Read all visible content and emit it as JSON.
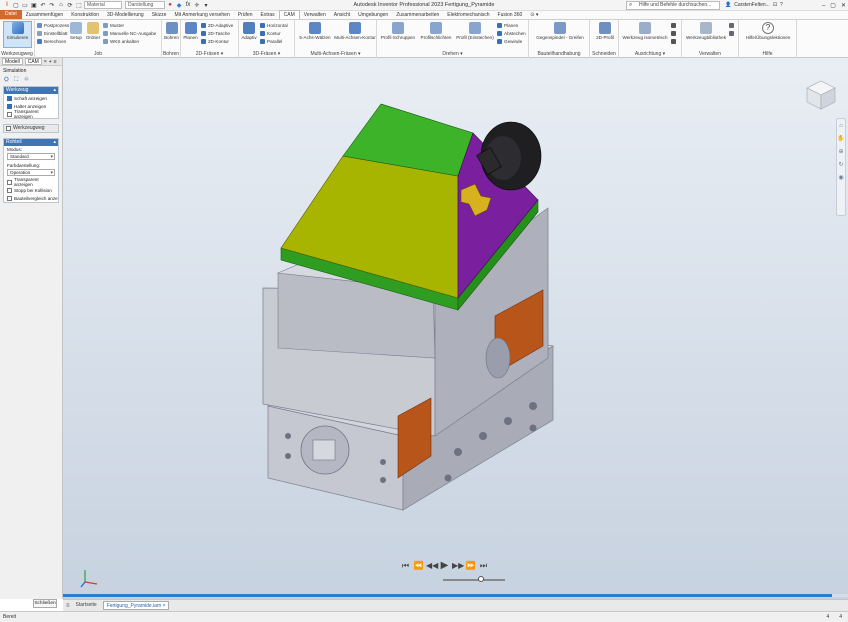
{
  "window": {
    "title": "Autodesk Inventor Professional 2023   Fertigung_Pyramide",
    "search_placeholder": "Hilfe und Befehle durchsuchen...",
    "user": "CarstenFelten...",
    "controls": [
      "–",
      "▢",
      "✕"
    ]
  },
  "qat": {
    "material": "Material",
    "appearance": "Darstellung",
    "fx": "fx"
  },
  "tabs": [
    {
      "label": "Datei"
    },
    {
      "label": "Zusammenfügen"
    },
    {
      "label": "Konstruktion"
    },
    {
      "label": "3D-Modellierung"
    },
    {
      "label": "Skizze"
    },
    {
      "label": "Mit Anmerkung versehen"
    },
    {
      "label": "Prüfen"
    },
    {
      "label": "Extras"
    },
    {
      "label": "CAM"
    },
    {
      "label": "Verwalten"
    },
    {
      "label": "Ansicht"
    },
    {
      "label": "Umgebungen"
    },
    {
      "label": "Zusammenarbeiten"
    },
    {
      "label": "Elektromechanisch"
    },
    {
      "label": "Fusion 360"
    },
    {
      "label": "⊙ ▾"
    }
  ],
  "ribbon": {
    "werkzeugweg": {
      "label": "Werkzeugweg",
      "simulate": "Simulieren"
    },
    "job": {
      "label": "Job",
      "setup": "Setup",
      "folder": "Ordner",
      "small": [
        "Postprozess",
        "Einstellblatt",
        "Berechnen"
      ],
      "small2": [
        "Muster",
        "Manuelle NC-Ausgabe",
        "WKS ankalten"
      ]
    },
    "bohren": {
      "label": "Bohren",
      "btn": "Bohren"
    },
    "fraesen2d": {
      "label": "2D-Fräsen ▾",
      "big": "Planen",
      "small": [
        "2D-Adaptive",
        "2D-Tasche",
        "2D-Kontur"
      ]
    },
    "fraesen3d": {
      "label": "3D-Fräsen ▾",
      "big": "Adaptiv",
      "small": [
        "Horizontal",
        "Kontur",
        "Parallel"
      ]
    },
    "multiachsen": {
      "label": "Multi-Achsen-Fräsen ▾",
      "b1": "5-Achs-Wälzen",
      "b2": "Multi-Achsen-Kontur"
    },
    "drehen": {
      "label": "Drehen ▾",
      "b1": "Profil-Schruppen",
      "b2": "Profilschlichten",
      "b3": "Profil (Einstechen)",
      "small": [
        "Planen",
        "Abstechen",
        "Gewinde"
      ]
    },
    "bauteil": {
      "label": "Bauteilhandhabung",
      "b1": "Gegenspindel - Greifen"
    },
    "schneiden": {
      "label": "Schneiden",
      "b1": "2D-Profil"
    },
    "ausrichtung": {
      "label": "Ausrichtung ▾",
      "b1": "Werkzeug isometrisch"
    },
    "verwalten": {
      "label": "Verwalten",
      "b1": "Werkzeugbibliothek"
    },
    "hilfe": {
      "label": "Hilfe",
      "b1": "Hilfe/Übungslektionen"
    }
  },
  "browser": {
    "tabs": [
      "Modell",
      "CAM"
    ],
    "title": "Simulation",
    "sections": {
      "tool": {
        "header": "Werkzeug",
        "items": [
          {
            "label": "Schaft anzeigen",
            "checked": true
          },
          {
            "label": "Halter anzeigen",
            "checked": true
          },
          {
            "label": "Transparent anzeigen",
            "checked": false
          }
        ]
      },
      "toolpath": {
        "header": "Werkzeugweg"
      },
      "stock": {
        "header": "Rohteil",
        "mode_label": "Modus:",
        "mode_value": "Standard",
        "color_label": "Farbdarstellung:",
        "color_value": "Operation",
        "items": [
          {
            "label": "Transparent anzeigen",
            "checked": false
          },
          {
            "label": "Stopp bei Kollision",
            "checked": false
          },
          {
            "label": "Bauteilvergleich anze",
            "checked": false
          }
        ]
      }
    },
    "close_button": "Schließen"
  },
  "viewport": {
    "model": "machine vise with pyramid workpiece and tool",
    "progress": 0.98,
    "playback": [
      "⏮",
      "⏪",
      "◀◀",
      "▶",
      "▶▶",
      "⏩",
      "⏭"
    ],
    "slider_position": 0.62,
    "nav_icons": [
      "home-icon",
      "pan-icon",
      "zoom-icon",
      "orbit-icon",
      "look-icon"
    ]
  },
  "doctabs": {
    "items": [
      "Startseite",
      "Fertigung_Pyramide.iam ×"
    ]
  },
  "status": {
    "text": "Bereit",
    "right": [
      "4",
      "4"
    ]
  },
  "colors": {
    "accent": "#d6682c",
    "ribbon_select": "#cfe5f7",
    "browser_header": "#3f74b5",
    "workpiece_green": "#3db32a",
    "workpiece_yellow": "#a8b500",
    "workpiece_purple": "#7a1f9e",
    "vise_gray": "#b7b9c4",
    "vise_orange": "#b8551a"
  }
}
